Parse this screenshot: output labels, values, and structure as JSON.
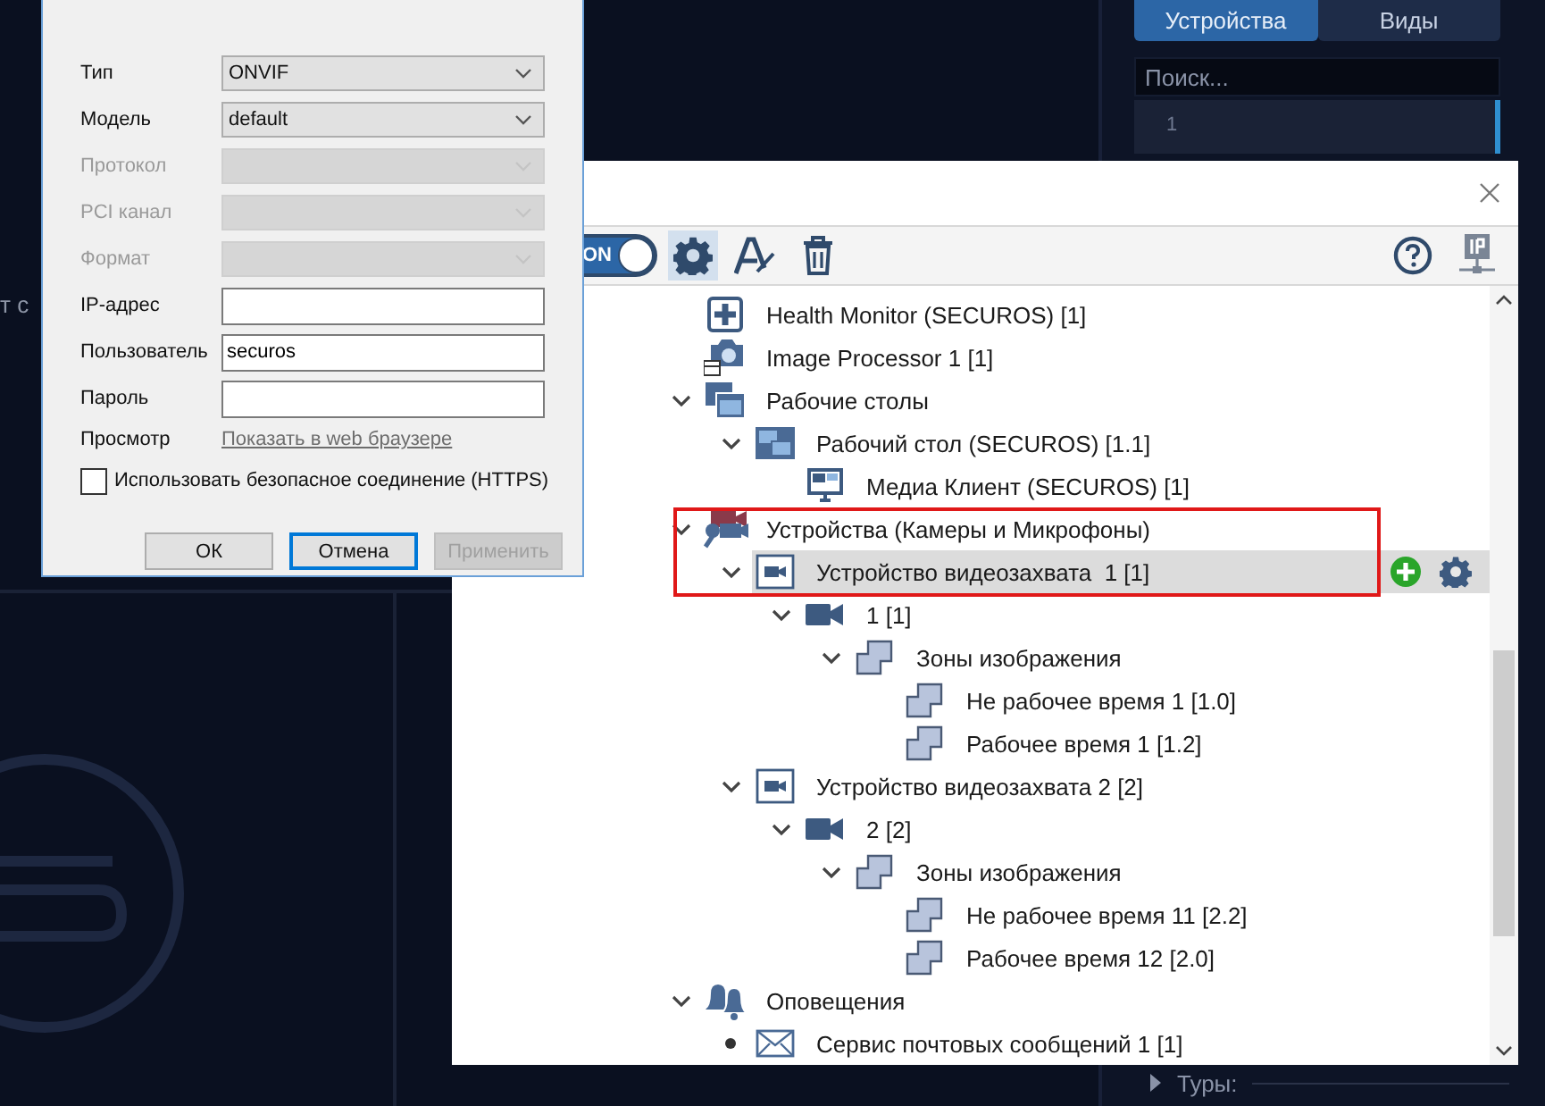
{
  "background_text": "т с",
  "side_panel": {
    "tabs": [
      {
        "label": "Устройства",
        "selected": true
      },
      {
        "label": "Виды",
        "selected": false
      }
    ],
    "search": {
      "placeholder": "Поиск..."
    },
    "items": [
      {
        "label": "1"
      }
    ],
    "section": {
      "label": "Туры:",
      "expanded": false
    }
  },
  "dialog": {
    "fields": [
      {
        "kind": "select",
        "label": "Тип",
        "value": "ONVIF",
        "disabled": false
      },
      {
        "kind": "select",
        "label": "Модель",
        "value": "default",
        "disabled": false
      },
      {
        "kind": "select",
        "label": "Протокол",
        "disabled": true
      },
      {
        "kind": "select",
        "label": "PCI канал",
        "disabled": true
      },
      {
        "kind": "select",
        "label": "Формат",
        "disabled": true
      },
      {
        "kind": "input",
        "label": "IP-адрес",
        "disabled": false
      },
      {
        "kind": "input",
        "label": "Пользователь",
        "value": "securos",
        "disabled": false
      },
      {
        "kind": "input",
        "label": "Пароль",
        "disabled": false
      },
      {
        "kind": "link",
        "label": "Просмотр",
        "value": "Показать в web браузере",
        "disabled": false
      },
      {
        "kind": "checkbox",
        "label": "Использовать безопасное соединение (HTTPS)",
        "checked": false,
        "disabled": false
      }
    ],
    "buttons": [
      {
        "label": "ОК",
        "focused": false,
        "disabled": false
      },
      {
        "label": "Отмена",
        "focused": true,
        "disabled": false
      },
      {
        "label": "Применить",
        "focused": false,
        "disabled": true
      }
    ]
  },
  "main_window": {
    "toggle": {
      "label": "ON",
      "on": true
    },
    "tools": [
      {
        "kind": "settings",
        "selected": true
      },
      {
        "kind": "rename",
        "selected": false
      },
      {
        "kind": "delete",
        "selected": false
      }
    ],
    "right_tools": [
      {
        "kind": "help"
      },
      {
        "kind": "ip"
      }
    ],
    "tree": {
      "items": [
        {
          "label": "Health Monitor (SECUROS) [1]",
          "kind": "health",
          "selected": false
        },
        {
          "label": "Image Processor 1 [1]",
          "kind": "photo",
          "selected": false
        },
        {
          "label": "Рабочие столы",
          "kind": "desktops",
          "selected": false,
          "expanded": true,
          "children": [
            {
              "label": "Рабочий стол (SECUROS) [1.1]",
              "kind": "desktop",
              "selected": false,
              "expanded": true,
              "children": [
                {
                  "label": "Медиа Клиент (SECUROS) [1]",
                  "kind": "monitor",
                  "selected": false
                }
              ]
            }
          ]
        },
        {
          "label": "Устройства (Камеры и Микрофоны)",
          "kind": "devices",
          "selected": false,
          "expanded": true,
          "children": [
            {
              "label": "Устройство видеозахвата  1 [1]",
              "kind": "capture",
              "selected": true,
              "expanded": true,
              "children": [
                {
                  "label": "1 [1]",
                  "kind": "camera",
                  "selected": false,
                  "expanded": true,
                  "children": [
                    {
                      "label": "Зоны изображения",
                      "kind": "zone",
                      "selected": false,
                      "expanded": true,
                      "children": [
                        {
                          "label": "Не рабочее время 1 [1.0]",
                          "kind": "zone",
                          "selected": false
                        },
                        {
                          "label": "Рабочее время 1 [1.2]",
                          "kind": "zone",
                          "selected": false
                        }
                      ]
                    }
                  ]
                }
              ]
            },
            {
              "label": "Устройство видеозахвата 2 [2]",
              "kind": "capture",
              "selected": false,
              "expanded": true,
              "children": [
                {
                  "label": "2 [2]",
                  "kind": "camera",
                  "selected": false,
                  "expanded": true,
                  "children": [
                    {
                      "label": "Зоны изображения",
                      "kind": "zone",
                      "selected": false,
                      "expanded": true,
                      "children": [
                        {
                          "label": "Не рабочее время 11 [2.2]",
                          "kind": "zone",
                          "selected": false
                        },
                        {
                          "label": "Рабочее время 12 [2.0]",
                          "kind": "zone",
                          "selected": false
                        }
                      ]
                    }
                  ]
                }
              ]
            }
          ]
        },
        {
          "label": "Оповещения",
          "kind": "bells",
          "selected": false,
          "expanded": true,
          "children": [
            {
              "label": "Сервис почтовых сообщений 1 [1]",
              "kind": "mail",
              "selected": false,
              "bullet": true
            }
          ]
        }
      ]
    }
  }
}
